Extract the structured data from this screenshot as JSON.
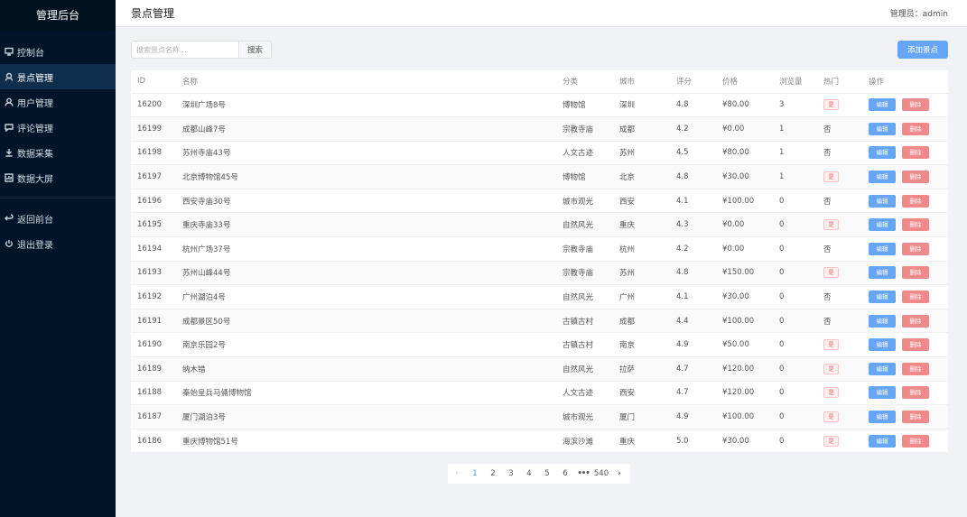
{
  "sidebar": {
    "brand": "管理后台",
    "items": [
      {
        "label": "控制台",
        "icon": "monitor-icon"
      },
      {
        "label": "景点管理",
        "icon": "location-icon",
        "active": true
      },
      {
        "label": "用户管理",
        "icon": "user-icon"
      },
      {
        "label": "评论管理",
        "icon": "comment-icon"
      },
      {
        "label": "数据采集",
        "icon": "download-icon"
      },
      {
        "label": "数据大屏",
        "icon": "chart-icon"
      }
    ],
    "bottom_items": [
      {
        "label": "返回前台",
        "icon": "return-icon"
      },
      {
        "label": "退出登录",
        "icon": "power-icon"
      }
    ]
  },
  "header": {
    "title": "景点管理",
    "admin_label": "管理员：admin"
  },
  "toolbar": {
    "search_placeholder": "搜索景点名称...",
    "search_button": "搜索",
    "add_button": "添加景点"
  },
  "table": {
    "columns": [
      "ID",
      "名称",
      "分类",
      "城市",
      "评分",
      "价格",
      "浏览量",
      "热门",
      "操作"
    ],
    "edit_label": "编辑",
    "delete_label": "删除",
    "hot_yes": "是",
    "hot_no": "否",
    "rows": [
      {
        "id": "16200",
        "name": "深圳广场8号",
        "category": "博物馆",
        "city": "深圳",
        "rating": "4.8",
        "price": "¥80.00",
        "views": "3",
        "hot": true
      },
      {
        "id": "16199",
        "name": "成都山峰7号",
        "category": "宗教寺庙",
        "city": "成都",
        "rating": "4.2",
        "price": "¥0.00",
        "views": "1",
        "hot": false
      },
      {
        "id": "16198",
        "name": "苏州寺庙43号",
        "category": "人文古迹",
        "city": "苏州",
        "rating": "4.5",
        "price": "¥80.00",
        "views": "1",
        "hot": false
      },
      {
        "id": "16197",
        "name": "北京博物馆45号",
        "category": "博物馆",
        "city": "北京",
        "rating": "4.8",
        "price": "¥30.00",
        "views": "1",
        "hot": true
      },
      {
        "id": "16196",
        "name": "西安寺庙30号",
        "category": "城市观光",
        "city": "西安",
        "rating": "4.1",
        "price": "¥100.00",
        "views": "0",
        "hot": false
      },
      {
        "id": "16195",
        "name": "重庆寺庙33号",
        "category": "自然风光",
        "city": "重庆",
        "rating": "4.3",
        "price": "¥0.00",
        "views": "0",
        "hot": true
      },
      {
        "id": "16194",
        "name": "杭州广场37号",
        "category": "宗教寺庙",
        "city": "杭州",
        "rating": "4.2",
        "price": "¥0.00",
        "views": "0",
        "hot": false
      },
      {
        "id": "16193",
        "name": "苏州山峰44号",
        "category": "宗教寺庙",
        "city": "苏州",
        "rating": "4.8",
        "price": "¥150.00",
        "views": "0",
        "hot": true
      },
      {
        "id": "16192",
        "name": "广州湖泊4号",
        "category": "自然风光",
        "city": "广州",
        "rating": "4.1",
        "price": "¥30.00",
        "views": "0",
        "hot": false
      },
      {
        "id": "16191",
        "name": "成都景区50号",
        "category": "古镇古村",
        "city": "成都",
        "rating": "4.4",
        "price": "¥100.00",
        "views": "0",
        "hot": false
      },
      {
        "id": "16190",
        "name": "南京乐园2号",
        "category": "古镇古村",
        "city": "南京",
        "rating": "4.9",
        "price": "¥50.00",
        "views": "0",
        "hot": true
      },
      {
        "id": "16189",
        "name": "纳木错",
        "category": "自然风光",
        "city": "拉萨",
        "rating": "4.7",
        "price": "¥120.00",
        "views": "0",
        "hot": true
      },
      {
        "id": "16188",
        "name": "秦始皇兵马俑博物馆",
        "category": "人文古迹",
        "city": "西安",
        "rating": "4.7",
        "price": "¥120.00",
        "views": "0",
        "hot": true
      },
      {
        "id": "16187",
        "name": "厦门湖泊3号",
        "category": "城市观光",
        "city": "厦门",
        "rating": "4.9",
        "price": "¥100.00",
        "views": "0",
        "hot": true
      },
      {
        "id": "16186",
        "name": "重庆博物馆51号",
        "category": "海滨沙滩",
        "city": "重庆",
        "rating": "5.0",
        "price": "¥30.00",
        "views": "0",
        "hot": true
      }
    ]
  },
  "pagination": {
    "prev": "‹",
    "next": "›",
    "pages": [
      "1",
      "2",
      "3",
      "4",
      "5",
      "6"
    ],
    "more": "•••",
    "last": "540",
    "current": "1"
  },
  "colors": {
    "sidebar_bg": "#001529",
    "primary": "#66a6f7",
    "danger": "#f08a8a"
  }
}
